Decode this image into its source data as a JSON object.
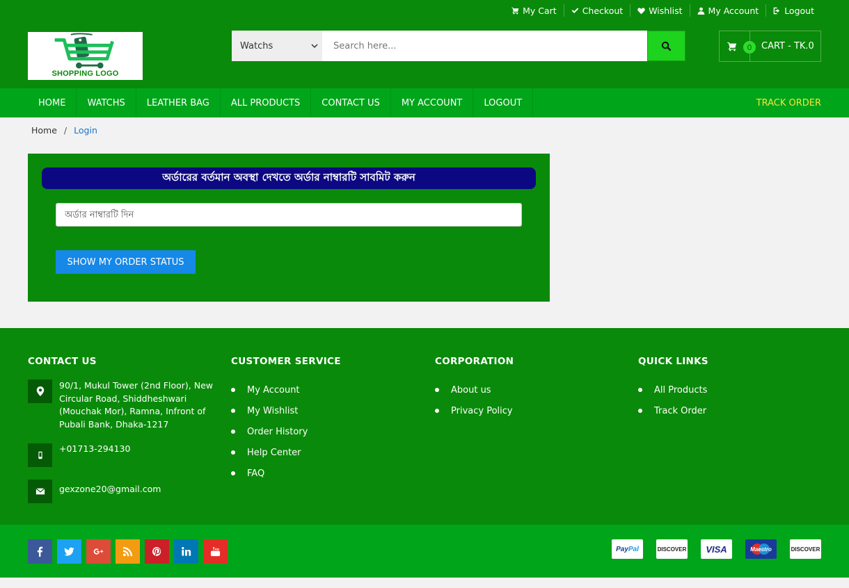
{
  "topbar": [
    {
      "label": "My Cart",
      "icon": "cart-icon"
    },
    {
      "label": "Checkout",
      "icon": "check-icon"
    },
    {
      "label": "Wishlist",
      "icon": "heart-icon"
    },
    {
      "label": "My Account",
      "icon": "user-icon"
    },
    {
      "label": "Logout",
      "icon": "logout-icon"
    }
  ],
  "logo": {
    "text": "SHOPPING LOGO"
  },
  "search": {
    "category": "Watchs",
    "placeholder": "Search here..."
  },
  "cart": {
    "count": "0",
    "label": "CART - TK.0"
  },
  "nav": {
    "items": [
      "HOME",
      "WATCHS",
      "LEATHER BAG",
      "ALL PRODUCTS",
      "CONTACT US",
      "MY ACCOUNT",
      "LOGOUT"
    ],
    "track": "TRACK ORDER"
  },
  "breadcrumb": {
    "home": "Home",
    "separator": "/",
    "current": "Login"
  },
  "track_panel": {
    "title": "অর্ডারের বর্তমান অবস্থা দেখতে অর্ডার নাম্বারটি সাবমিট করুন",
    "input_placeholder": "অর্ডার নাম্বারটি দিন",
    "button": "SHOW MY ORDER STATUS"
  },
  "footer": {
    "contact": {
      "heading": "CONTACT US",
      "address": "90/1, Mukul Tower (2nd Floor), New Circular Road, Shiddheshwari (Mouchak Mor), Ramna, Infront of Pubali Bank, Dhaka-1217",
      "phone": "+01713-294130",
      "email": "gexzone20@gmail.com"
    },
    "customer_service": {
      "heading": "CUSTOMER SERVICE",
      "items": [
        "My Account",
        "My Wishlist",
        "Order History",
        "Help Center",
        "FAQ"
      ]
    },
    "corporation": {
      "heading": "CORPORATION",
      "items": [
        "About us",
        "Privacy Policy"
      ]
    },
    "quick_links": {
      "heading": "QUICK LINKS",
      "items": [
        "All Products",
        "Track Order"
      ]
    }
  },
  "social": [
    {
      "name": "facebook",
      "color": "#3b5998"
    },
    {
      "name": "twitter",
      "color": "#1da1f2"
    },
    {
      "name": "google-plus",
      "color": "#dd4b39"
    },
    {
      "name": "rss",
      "color": "#f39c12"
    },
    {
      "name": "pinterest",
      "color": "#cb2027"
    },
    {
      "name": "linkedin",
      "color": "#0077b5"
    },
    {
      "name": "youtube",
      "color": "#e52d27"
    }
  ],
  "payments": [
    "PayPal",
    "DISCOVER",
    "VISA",
    "Maestro",
    "DISCOVER"
  ],
  "colors": {
    "header_bg": "#0a8a0a",
    "nav_bg": "#00a51a",
    "accent_yellow": "#f5e63c",
    "title_bar": "#0c0882",
    "button_blue": "#1688e8"
  }
}
